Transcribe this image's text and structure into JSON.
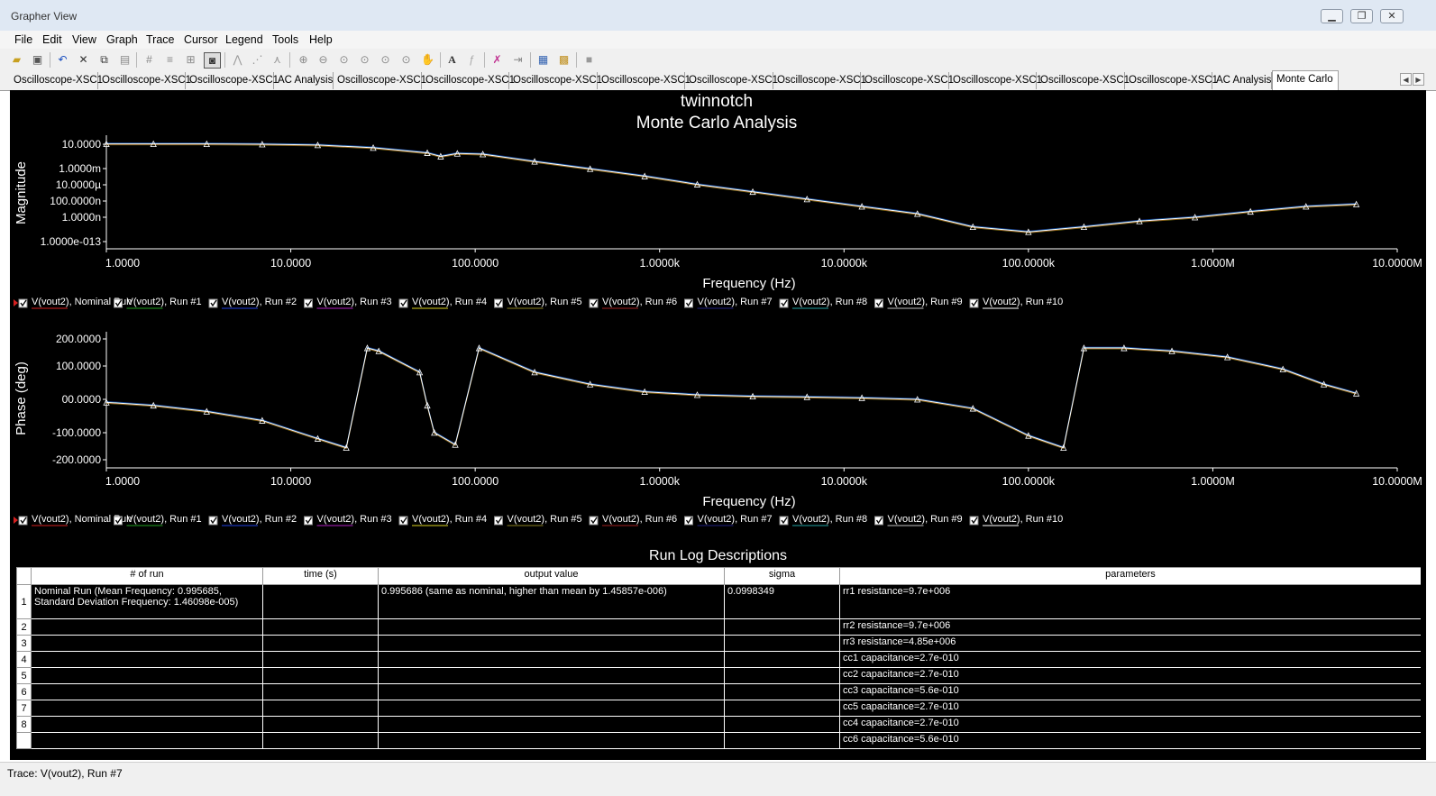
{
  "window": {
    "title": "Grapher View",
    "controls": [
      "▁",
      "❐",
      "✕"
    ]
  },
  "menu": [
    "File",
    "Edit",
    "View",
    "Graph",
    "Trace",
    "Cursor",
    "Legend",
    "Tools",
    "Help"
  ],
  "tabs": [
    "Oscilloscope-XSC1",
    "Oscilloscope-XSC1",
    "Oscilloscope-XSC1",
    "AC Analysis",
    "Oscilloscope-XSC1",
    "Oscilloscope-XSC1",
    "Oscilloscope-XSC1",
    "Oscilloscope-XSC1",
    "Oscilloscope-XSC1",
    "Oscilloscope-XSC1",
    "Oscilloscope-XSC1",
    "Oscilloscope-XSC1",
    "Oscilloscope-XSC1",
    "Oscilloscope-XSC1",
    "AC Analysis",
    "Monte Carlo"
  ],
  "active_tab": "Monte Carlo",
  "graph": {
    "title": "twinnotch",
    "subtitle": "Monte Carlo Analysis",
    "x_ticks": [
      "1.0000",
      "10.0000",
      "100.0000",
      "1.0000k",
      "10.0000k",
      "100.0000k",
      "1.0000M",
      "10.0000M"
    ]
  },
  "chart_data": [
    {
      "type": "line",
      "ylabel": "Magnitude",
      "xlabel": "Frequency (Hz)",
      "x_scale": "log",
      "y_scale": "log",
      "x_range": [
        1,
        10000000
      ],
      "y_ticks": [
        "10.0000",
        "1.0000m",
        "10.0000µ",
        "100.0000n",
        "1.0000n",
        "1.0000e-013"
      ],
      "x": [
        1,
        1.8,
        3.5,
        7,
        14,
        28,
        55,
        65,
        80,
        110,
        210,
        420,
        830,
        1600,
        3200,
        6300,
        12500,
        25000,
        50000,
        100000,
        200000,
        400000,
        800000,
        1600000,
        3200000,
        6000000
      ],
      "y": [
        10,
        10,
        10,
        9,
        7,
        3,
        0.6,
        0.2,
        0.5,
        0.4,
        0.04,
        0.004,
        0.0004,
        3e-05,
        3e-06,
        3e-07,
        3e-08,
        3e-09,
        5e-11,
        1e-11,
        5e-11,
        3e-10,
        1e-09,
        6e-09,
        3e-08,
        6e-08
      ]
    },
    {
      "type": "line",
      "ylabel": "Phase (deg)",
      "xlabel": "Frequency (Hz)",
      "x_scale": "log",
      "x_range": [
        1,
        10000000
      ],
      "y_ticks": [
        "200.0000",
        "100.0000",
        "00.0000",
        "-100.0000",
        "-200.0000"
      ],
      "ylim": [
        -200,
        200
      ],
      "x": [
        1,
        1.8,
        3.5,
        7,
        14,
        20,
        26,
        30,
        50,
        55,
        60,
        78,
        105,
        210,
        420,
        830,
        1600,
        3200,
        6300,
        12500,
        25000,
        50000,
        100000,
        155000,
        200000,
        330000,
        600000,
        1200000,
        2400000,
        4000000,
        6000000
      ],
      "y": [
        -10,
        -20,
        -40,
        -70,
        -130,
        -160,
        170,
        160,
        90,
        -20,
        -110,
        -150,
        170,
        90,
        50,
        25,
        15,
        10,
        8,
        5,
        0,
        -30,
        -120,
        -160,
        170,
        170,
        160,
        140,
        100,
        50,
        20
      ]
    }
  ],
  "legend": [
    {
      "label": "V(vout2), Nominal Run",
      "color": "#d42020"
    },
    {
      "label": "V(vout2), Run #1",
      "color": "#20a020"
    },
    {
      "label": "V(vout2), Run #2",
      "color": "#2040e0"
    },
    {
      "label": "V(vout2), Run #3",
      "color": "#b020c0"
    },
    {
      "label": "V(vout2), Run #4",
      "color": "#d8d020"
    },
    {
      "label": "V(vout2), Run #5",
      "color": "#8a8020"
    },
    {
      "label": "V(vout2), Run #6",
      "color": "#a02020"
    },
    {
      "label": "V(vout2), Run #7",
      "color": "#202080"
    },
    {
      "label": "V(vout2), Run #8",
      "color": "#20a0a0"
    },
    {
      "label": "V(vout2), Run #9",
      "color": "#c0c0c0"
    },
    {
      "label": "V(vout2), Run #10",
      "color": "#ffffff"
    }
  ],
  "run_log": {
    "title": "Run Log Descriptions",
    "columns": [
      "# of run",
      "time (s)",
      "output value",
      "sigma",
      "parameters"
    ],
    "rows": [
      {
        "n": "1",
        "run": "Nominal Run (Mean Frequency: 0.995685,  Standard Deviation Frequency: 1.46098e-005)",
        "time": "",
        "output": "0.995686 (same as nominal,  higher than mean by 1.45857e-006)",
        "sigma": "0.0998349",
        "params": "rr1 resistance=9.7e+006"
      },
      {
        "n": "2",
        "run": "",
        "time": "",
        "output": "",
        "sigma": "",
        "params": "rr2 resistance=9.7e+006"
      },
      {
        "n": "3",
        "run": "",
        "time": "",
        "output": "",
        "sigma": "",
        "params": "rr3 resistance=4.85e+006"
      },
      {
        "n": "4",
        "run": "",
        "time": "",
        "output": "",
        "sigma": "",
        "params": "cc1 capacitance=2.7e-010"
      },
      {
        "n": "5",
        "run": "",
        "time": "",
        "output": "",
        "sigma": "",
        "params": "cc2 capacitance=2.7e-010"
      },
      {
        "n": "6",
        "run": "",
        "time": "",
        "output": "",
        "sigma": "",
        "params": "cc3 capacitance=5.6e-010"
      },
      {
        "n": "7",
        "run": "",
        "time": "",
        "output": "",
        "sigma": "",
        "params": "cc5 capacitance=2.7e-010"
      },
      {
        "n": "8",
        "run": "",
        "time": "",
        "output": "",
        "sigma": "",
        "params": "cc4 capacitance=2.7e-010"
      },
      {
        "n": "",
        "run": "",
        "time": "",
        "output": "",
        "sigma": "",
        "params": "cc6 capacitance=5.6e-010"
      }
    ]
  },
  "status": "Trace: V(vout2), Run #7"
}
